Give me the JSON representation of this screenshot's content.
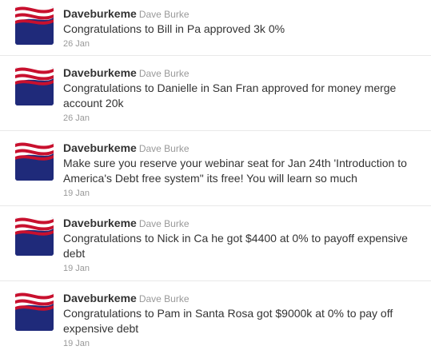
{
  "tweets": [
    {
      "username": "Daveburkeme",
      "fullname": "Dave Burke",
      "text": "Congratulations to Bill in Pa approved 3k 0%",
      "time": "26 Jan",
      "avatar_icon": "american-flag-icon"
    },
    {
      "username": "Daveburkeme",
      "fullname": "Dave Burke",
      "text": "Congratulations to Danielle in San Fran approved for money merge account 20k",
      "time": "26 Jan",
      "avatar_icon": "american-flag-icon"
    },
    {
      "username": "Daveburkeme",
      "fullname": "Dave Burke",
      "text": "Make sure you reserve your webinar seat for Jan 24th 'Introduction to America's Debt free system\" its free! You will learn so much",
      "time": "19 Jan",
      "avatar_icon": "american-flag-icon"
    },
    {
      "username": "Daveburkeme",
      "fullname": "Dave Burke",
      "text": "Congratulations to Nick in Ca he got $4400 at 0% to payoff expensive debt",
      "time": "19 Jan",
      "avatar_icon": "american-flag-icon"
    },
    {
      "username": "Daveburkeme",
      "fullname": "Dave Burke",
      "text": "Congratulations to Pam in Santa Rosa got $9000k at 0% to pay off expensive debt",
      "time": "19 Jan",
      "avatar_icon": "american-flag-icon"
    }
  ],
  "colors": {
    "flag_red": "#c8102e",
    "flag_blue": "#1f2a7a",
    "text": "#333333",
    "muted": "#999999"
  }
}
